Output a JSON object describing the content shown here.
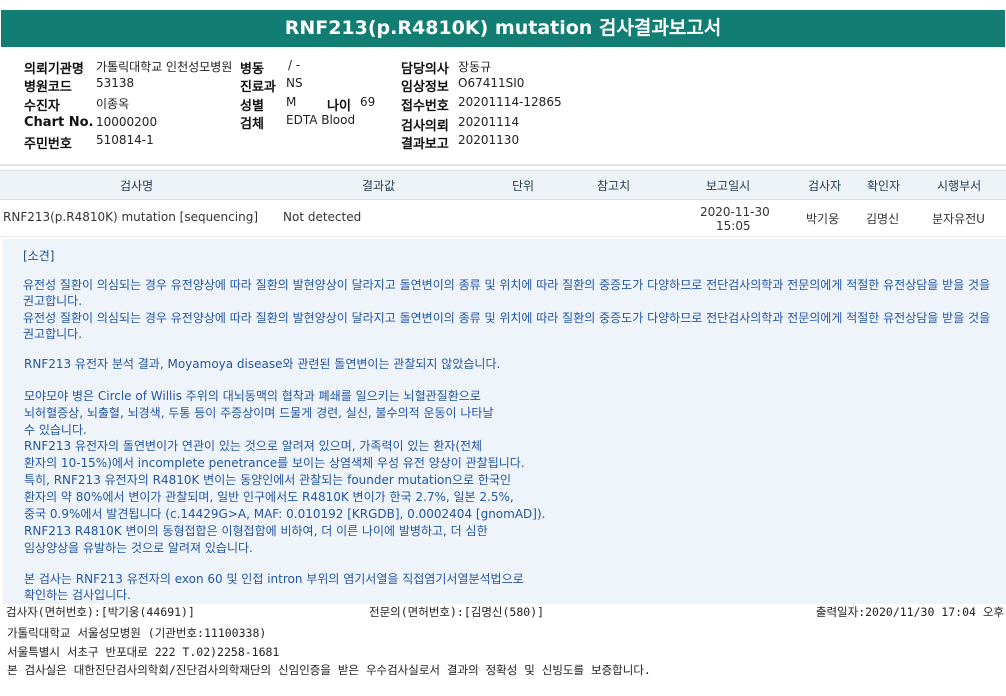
{
  "title": "RNF213(p.R4810K) mutation 검사결과보고서",
  "patient": {
    "institution_label": "의뢰기관명",
    "institution": "가톨릭대학교 인천성모병원",
    "ward_label": "병동",
    "ward": "/ -",
    "doctor_label": "담당의사",
    "doctor": "장동규",
    "hospital_code_label": "병원코드",
    "hospital_code": "53138",
    "dept_label": "진료과",
    "dept": "NS",
    "clinical_label": "임상정보",
    "clinical": "O67411SI0",
    "receiver_label": "수진자",
    "receiver": "이종옥",
    "sex_label": "성별",
    "sex": "M",
    "age_label": "나이",
    "age": "69",
    "accession_label": "접수번호",
    "accession": "20201114-12865",
    "chart_label": "Chart No.",
    "chart": "10000200",
    "specimen_label": "검체",
    "specimen": "EDTA Blood",
    "request_label": "검사의뢰",
    "request": "20201114",
    "ssn_label": "주민번호",
    "ssn": "510814-1",
    "report_label": "결과보고",
    "report": "20201130"
  },
  "results": {
    "headers": {
      "test": "검사명",
      "result": "결과값",
      "unit": "단위",
      "ref": "참고치",
      "report_date": "보고일시",
      "tester": "검사자",
      "confirmer": "확인자",
      "lab": "시행부서"
    },
    "rows": [
      {
        "test": "RNF213(p.R4810K) mutation [sequencing]",
        "result": "Not detected",
        "date": "2020-11-30",
        "time": "15:05",
        "tester": "박기웅",
        "confirmer": "김명신",
        "lab": "분자유전U"
      }
    ]
  },
  "comment": {
    "title": "[소견]",
    "paragraph1": "유전성 질환이 의심되는 경우 유전양상에 따라 질환의 발현양상이 달라지고 돌연변이의 종류 및 위치에 따라 질환의 중증도가 다양하므로 전단검사의학과 전문의에게 적절한 유전상담을 받을 것을 권고합니다.",
    "paragraph2": "유전성 질환이 의심되는 경우 유전양상에 따라 질환의 발현양상이 달라지고 돌연변이의 종류 및 위치에 따라 질환의 중증도가 다양하므로 전단검사의학과 전문의에게 적절한 유전상담을 받을 것을 권고합니다.",
    "result_line": "RNF213 유전자 분석 결과, Moyamoya disease와 관련된 돌연변이는 관찰되지 않았습니다.",
    "lines": [
      "모야모야 병은 Circle of Willis 주위의 대뇌동맥의 협착과 폐쇄를 일으키는 뇌혈관질환으로",
      "뇌허혈증상, 뇌출혈, 뇌경색, 두통 등이 주증상이며 드물게 경련, 실신, 불수의적 운동이 나타날",
      "수 있습니다.",
      "RNF213 유전자의 돌연변이가 연관이 있는 것으로 알려져 있으며, 가족력이 있는 환자(전체",
      "환자의 10-15%)에서 incomplete penetrance를 보이는 상염색체 우성 유전 양상이 관찰됩니다.",
      "특히, RNF213 유전자의 R4810K 변이는 동양인에서 관찰되는 founder mutation으로 한국인",
      "환자의 약 80%에서 변이가 관찰되며, 일반 인구에서도 R4810K 변이가 한국 2.7%, 일본 2.5%,",
      "중국 0.9%에서 발견됩니다 (c.14429G>A, MAF: 0.010192 [KRGDB], 0.0002404 [gnomAD]).",
      "RNF213 R4810K 변이의 동형접합은 이형접합에 비하여, 더 이른 나이에 발병하고, 더 심한",
      "임상양상을 유발하는 것으로 알려져 있습니다."
    ],
    "method_lines": [
      "본 검사는 RNF213 유전자의 exon 60 및 인접 intron 부위의 염기서열을 직접염기서열분석법으로",
      "확인하는 검사입니다."
    ]
  },
  "footer": {
    "tester": "검사자(면허번호):[박기웅(44691)]",
    "specialist": "전문의(면허번호):[김명신(580)]",
    "output_date": "출력일자:2020/11/30 17:04 오후",
    "hospital": "가톨릭대학교 서울성모병원 (기관번호:11100338)",
    "address": "서울특별시 서초구 반포대로 222 T.02)2258-1681",
    "certification": "본 검사실은 대한진단검사의학회/진단검사의학재단의 신임인증을 받은 우수검사실로서 결과의 정확성 및 신빙도를 보증합니다."
  },
  "colors": {
    "title_bg": "#117d73",
    "comment_bg": "#eef4fa",
    "comment_text": "#2456a4"
  }
}
